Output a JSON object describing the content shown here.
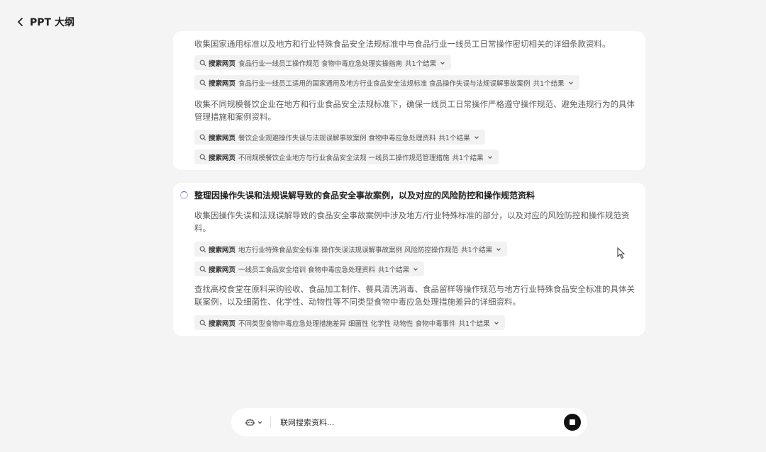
{
  "header": {
    "title": "PPT 大纲"
  },
  "card1": {
    "top_desc": "收集国家通用标准以及地方和行业特殊食品安全法规标准中与食品行业一线员工日常操作密切相关的详细条款资料。",
    "chips_a": [
      {
        "label": "搜索网页",
        "query": "食品行业一线员工操作规范 食物中毒应急处理实操指南",
        "count": "共1个结果"
      },
      {
        "label": "搜索网页",
        "query": "食品行业一线员工适用的国家通用及地方行业食品安全法规标准 食品操作失误与法规误解事故案例",
        "count": "共1个结果"
      }
    ],
    "desc2": "收集不同规模餐饮企业在地方和行业食品安全法规标准下，确保一线员工日常操作严格遵守操作规范、避免违规行为的具体管理措施和案例资料。",
    "chips_b": [
      {
        "label": "搜索网页",
        "query": "餐饮企业规避操作失误与法规误解事故案例 食物中毒应急处理资料",
        "count": "共1个结果"
      },
      {
        "label": "搜索网页",
        "query": "不同规模餐饮企业地方与行业食品安全法规 一线员工操作规范管理措施",
        "count": "共1个结果"
      }
    ]
  },
  "card2": {
    "title": "整理因操作失误和法规误解导致的食品安全事故案例，以及对应的风险防控和操作规范资料",
    "desc1": "收集因操作失误和法规误解导致的食品安全事故案例中涉及地方/行业特殊标准的部分，以及对应的风险防控和操作规范资料。",
    "chips_a": [
      {
        "label": "搜索网页",
        "query": "地方行业特殊食品安全标准 操作失误法规误解事故案例 风险防控操作规范",
        "count": "共1个结果"
      },
      {
        "label": "搜索网页",
        "query": "一线员工食品安全培训 食物中毒应急处理资料",
        "count": "共1个结果"
      }
    ],
    "desc2": "查找高校食堂在原料采购验收、食品加工制作、餐具清洗消毒、食品留样等操作规范与地方行业特殊食品安全标准的具体关联案例，以及细菌性、化学性、动物性等不同类型食物中毒应急处理措施差异的详细资料。",
    "chips_b": [
      {
        "label": "搜索网页",
        "query": "不同类型食物中毒应急处理措施差异 细菌性 化学性 动物性 食物中毒事件",
        "count": "共1个结果"
      }
    ]
  },
  "input": {
    "placeholder": "联网搜索资料..."
  },
  "icons": {
    "back": "chevron-left-icon",
    "chip": "search-icon",
    "chevron": "chevron-down-icon",
    "tool": "robot-icon",
    "stop": "stop-icon"
  },
  "colors": {
    "spinner": "#6b5bd2",
    "stop": "#111111"
  }
}
